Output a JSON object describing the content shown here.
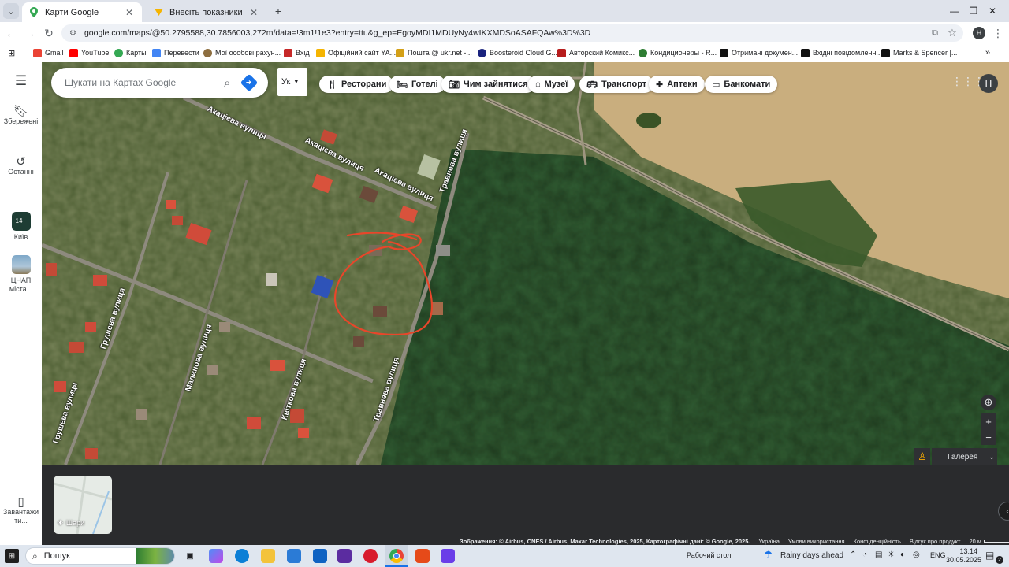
{
  "browser": {
    "tabs": [
      {
        "title": "Карти Google",
        "active": true
      },
      {
        "title": "Внесіть показники",
        "active": false
      }
    ],
    "url": "google.com/maps/@50.2795588,30.7856003,272m/data=!3m1!1e3?entry=ttu&g_ep=EgoyMDI1MDUyNy4wIKXMDSoASAFQAw%3D%3D",
    "profile_initial": "H",
    "bookmarks": [
      "Gmail",
      "YouTube",
      "Карты",
      "Перевести",
      "Мої особові рахун...",
      "Вхід",
      "Офіційний сайт YA...",
      "Пошта @ ukr.net -...",
      "Boosteroid Cloud G...",
      "Авторский Комикс...",
      "Кондиционеры - R...",
      "Отримані докумен...",
      "Вхідні повідомленн...",
      "Marks & Spencer |..."
    ]
  },
  "maps": {
    "rail": {
      "saved": "Збережені",
      "recent": "Останні",
      "place1": "Київ",
      "place1_badge": "14",
      "place2": "ЦНАП міста...",
      "download": "Завантажити..."
    },
    "search": {
      "placeholder": "Шукати на Картах Google"
    },
    "language": "Ук",
    "chips": [
      "Ресторани",
      "Готелі",
      "Чим зайнятися",
      "Музеї",
      "Транспорт",
      "Аптеки",
      "Банкомати"
    ],
    "account_initial": "H",
    "streets": [
      "Акацієва вулиця",
      "Акацієва вулиця",
      "Травнева вулиця",
      "Травнева вулиця",
      "Грушева вулиця",
      "Грушева вулиця",
      "Малинова вулиця",
      "Квіткова вулиця"
    ],
    "layers_label": "Шари",
    "gallery_label": "Галерея",
    "footer": {
      "imagery": "Зображення: © Airbus, CNES / Airbus, Maxar Technologies, 2025, Картографічні дані: © Google, 2025.",
      "country": "Україна",
      "terms": "Умови використання",
      "privacy": "Конфіденційність",
      "feedback": "Відгук про продукт",
      "scale": "20 м"
    }
  },
  "taskbar": {
    "search": "Пошук",
    "desktop": "Рабочий стол",
    "weather": "Rainy days ahead",
    "lang": "ENG",
    "time": "13:14",
    "date": "30.05.2025",
    "notifications": "2"
  },
  "colors": {
    "accent": "#1a73e8",
    "annotation": "#e8462a"
  }
}
